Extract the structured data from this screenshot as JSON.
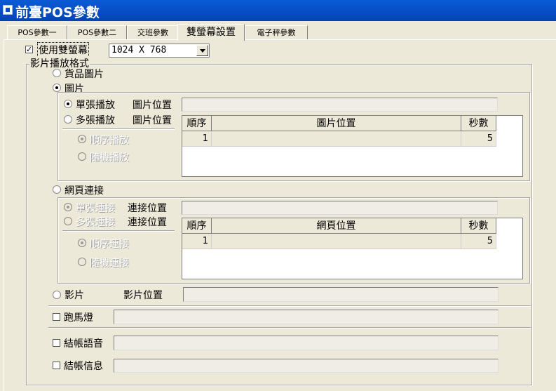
{
  "window": {
    "title": "前臺POS參數"
  },
  "tabs": [
    {
      "label": "POS參數一"
    },
    {
      "label": "POS參數二"
    },
    {
      "label": "交班參數"
    },
    {
      "label": "雙螢幕設置",
      "active": true
    },
    {
      "label": "電子秤參數"
    }
  ],
  "dual_screen": {
    "checkbox_label": "使用雙螢幕",
    "checked": true,
    "resolution": "1024 X 768"
  },
  "video_format": {
    "label": "影片播放格式",
    "product_image": "貨品圖片",
    "image": "圖片",
    "image_selected": true,
    "single_play": "單張播放",
    "multi_play": "多張播放",
    "image_position_label": "圖片位置",
    "sequential_play": "順序播放",
    "random_play": "隨機播放",
    "image_grid": {
      "headers": [
        "順序",
        "圖片位置",
        "秒數"
      ],
      "rows": [
        {
          "order": "1",
          "position": "",
          "seconds": "5"
        }
      ]
    },
    "webpage": "網頁連接",
    "single_link": "單張連接",
    "multi_link": "多張連接",
    "link_position_label": "連接位置",
    "sequential_link": "順序連接",
    "random_link": "隨機連接",
    "web_grid": {
      "headers": [
        "順序",
        "網頁位置",
        "秒數"
      ],
      "rows": [
        {
          "order": "1",
          "position": "",
          "seconds": "5"
        }
      ]
    },
    "video": "影片",
    "video_position_label": "影片位置"
  },
  "marquee": {
    "label": "跑馬燈"
  },
  "checkout_voice": {
    "label": "結帳語音"
  },
  "checkout_message": {
    "label": "結帳信息"
  }
}
